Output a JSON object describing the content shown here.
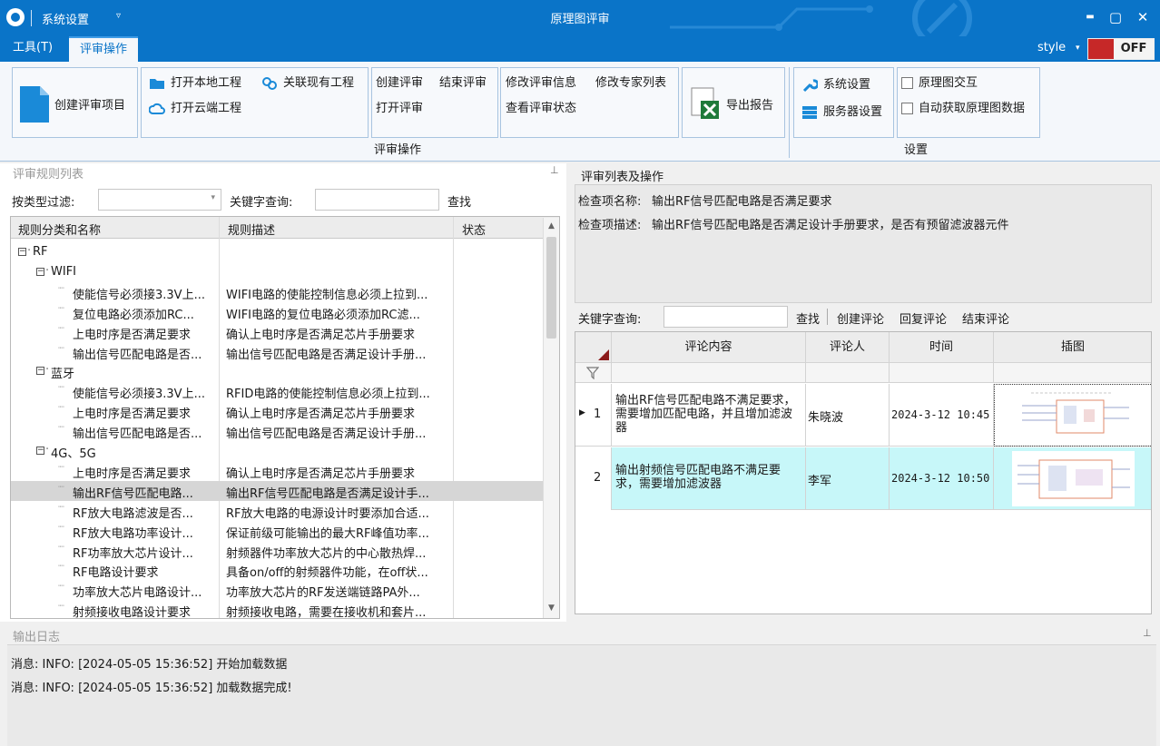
{
  "titlebar": {
    "app_menu_label": "系统设置",
    "window_title": "原理图评审",
    "minimize": "▬",
    "maximize": "▢",
    "close": "✕",
    "qa_dropdown": "▿"
  },
  "tabs": [
    {
      "label": "工具(T)"
    },
    {
      "label": "评审操作",
      "active": true
    }
  ],
  "style": {
    "label": "style",
    "caret": "▾",
    "toggle": "OFF"
  },
  "ribbon": {
    "create_project": "创建评审项目",
    "open_local": "打开本地工程",
    "open_cloud": "打开云端工程",
    "link_existing": "关联现有工程",
    "create_review": "创建评审",
    "end_review": "结束评审",
    "open_review": "打开评审",
    "modify_review_info": "修改评审信息",
    "modify_expert_list": "修改专家列表",
    "view_review_status": "查看评审状态",
    "export_report": "导出报告",
    "system_settings": "系统设置",
    "server_settings": "服务器设置",
    "schematic_interact": "原理图交互",
    "auto_fetch": "自动获取原理图数据",
    "group_review_ops": "评审操作",
    "group_settings": "设置"
  },
  "rules_panel": {
    "caption": "评审规则列表",
    "filter_label": "按类型过滤:",
    "keyword_label": "关键字查询:",
    "search_button": "查找",
    "columns": [
      "规则分类和名称",
      "规则描述",
      "状态"
    ],
    "tree": [
      {
        "level": 0,
        "name": "RF",
        "expander": "−"
      },
      {
        "level": 1,
        "name": "WIFI",
        "expander": "−"
      },
      {
        "level": 2,
        "name": "使能信号必须接3.3V上...",
        "desc": "WIFI电路的使能控制信息必须上拉到..."
      },
      {
        "level": 2,
        "name": "复位电路必须添加RC...",
        "desc": "WIFI电路的复位电路必须添加RC滤..."
      },
      {
        "level": 2,
        "name": "上电时序是否满足要求",
        "desc": "确认上电时序是否满足芯片手册要求"
      },
      {
        "level": 2,
        "name": "输出信号匹配电路是否...",
        "desc": "输出信号匹配电路是否满足设计手册..."
      },
      {
        "level": 1,
        "name": "蓝牙",
        "expander": "−"
      },
      {
        "level": 2,
        "name": "使能信号必须接3.3V上...",
        "desc": "RFID电路的使能控制信息必须上拉到..."
      },
      {
        "level": 2,
        "name": "上电时序是否满足要求",
        "desc": "确认上电时序是否满足芯片手册要求"
      },
      {
        "level": 2,
        "name": "输出信号匹配电路是否...",
        "desc": "输出信号匹配电路是否满足设计手册..."
      },
      {
        "level": 1,
        "name": "4G、5G",
        "expander": "−"
      },
      {
        "level": 2,
        "name": "上电时序是否满足要求",
        "desc": "确认上电时序是否满足芯片手册要求"
      },
      {
        "level": 2,
        "name": "输出RF信号匹配电路...",
        "desc": "输出RF信号匹配电路是否满足设计手...",
        "selected": true
      },
      {
        "level": 2,
        "name": "RF放大电路滤波是否...",
        "desc": "RF放大电路的电源设计时要添加合适..."
      },
      {
        "level": 2,
        "name": "RF放大电路功率设计...",
        "desc": "保证前级可能输出的最大RF峰值功率..."
      },
      {
        "level": 2,
        "name": "RF功率放大芯片设计...",
        "desc": "射频器件功率放大芯片的中心散热焊..."
      },
      {
        "level": 2,
        "name": "RF电路设计要求",
        "desc": "具备on/off的射频器件功能，在off状..."
      },
      {
        "level": 2,
        "name": "功率放大芯片电路设计...",
        "desc": "功率放大芯片的RF发送端链路PA外..."
      },
      {
        "level": 2,
        "name": "射频接收电路设计要求",
        "desc": "射频接收电路，需要在接收机和套片..."
      }
    ]
  },
  "review_panel": {
    "caption": "评审列表及操作",
    "item_name_label": "检查项名称:",
    "item_name": "输出RF信号匹配电路是否满足要求",
    "item_desc_label": "检查项描述:",
    "item_desc": "输出RF信号匹配电路是否满足设计手册要求，是否有预留滤波器元件",
    "keyword_label": "关键字查询:",
    "search": "查找",
    "create_comment": "创建评论",
    "reply_comment": "回复评论",
    "end_comment": "结束评论",
    "columns": [
      "评论内容",
      "评论人",
      "时间",
      "插图"
    ],
    "comments": [
      {
        "index": "1",
        "content": "输出RF信号匹配电路不满足要求，需要增加匹配电路，并且增加滤波器",
        "author": "朱晓波",
        "time": "2024-3-12 10:45"
      },
      {
        "index": "2",
        "content": "输出射频信号匹配电路不满足要求，需要增加滤波器",
        "author": "李军",
        "time": "2024-3-12 10:50"
      }
    ]
  },
  "log": {
    "caption": "输出日志",
    "lines": [
      "消息:  INFO: [2024-05-05 15:36:52]  开始加载数据",
      "消息:  INFO: [2024-05-05 15:36:52]  加载数据完成!"
    ]
  },
  "colors": {
    "accent": "#0a74c8",
    "highlight_row": "#c7f7f9",
    "toggle_red": "#c62828"
  }
}
